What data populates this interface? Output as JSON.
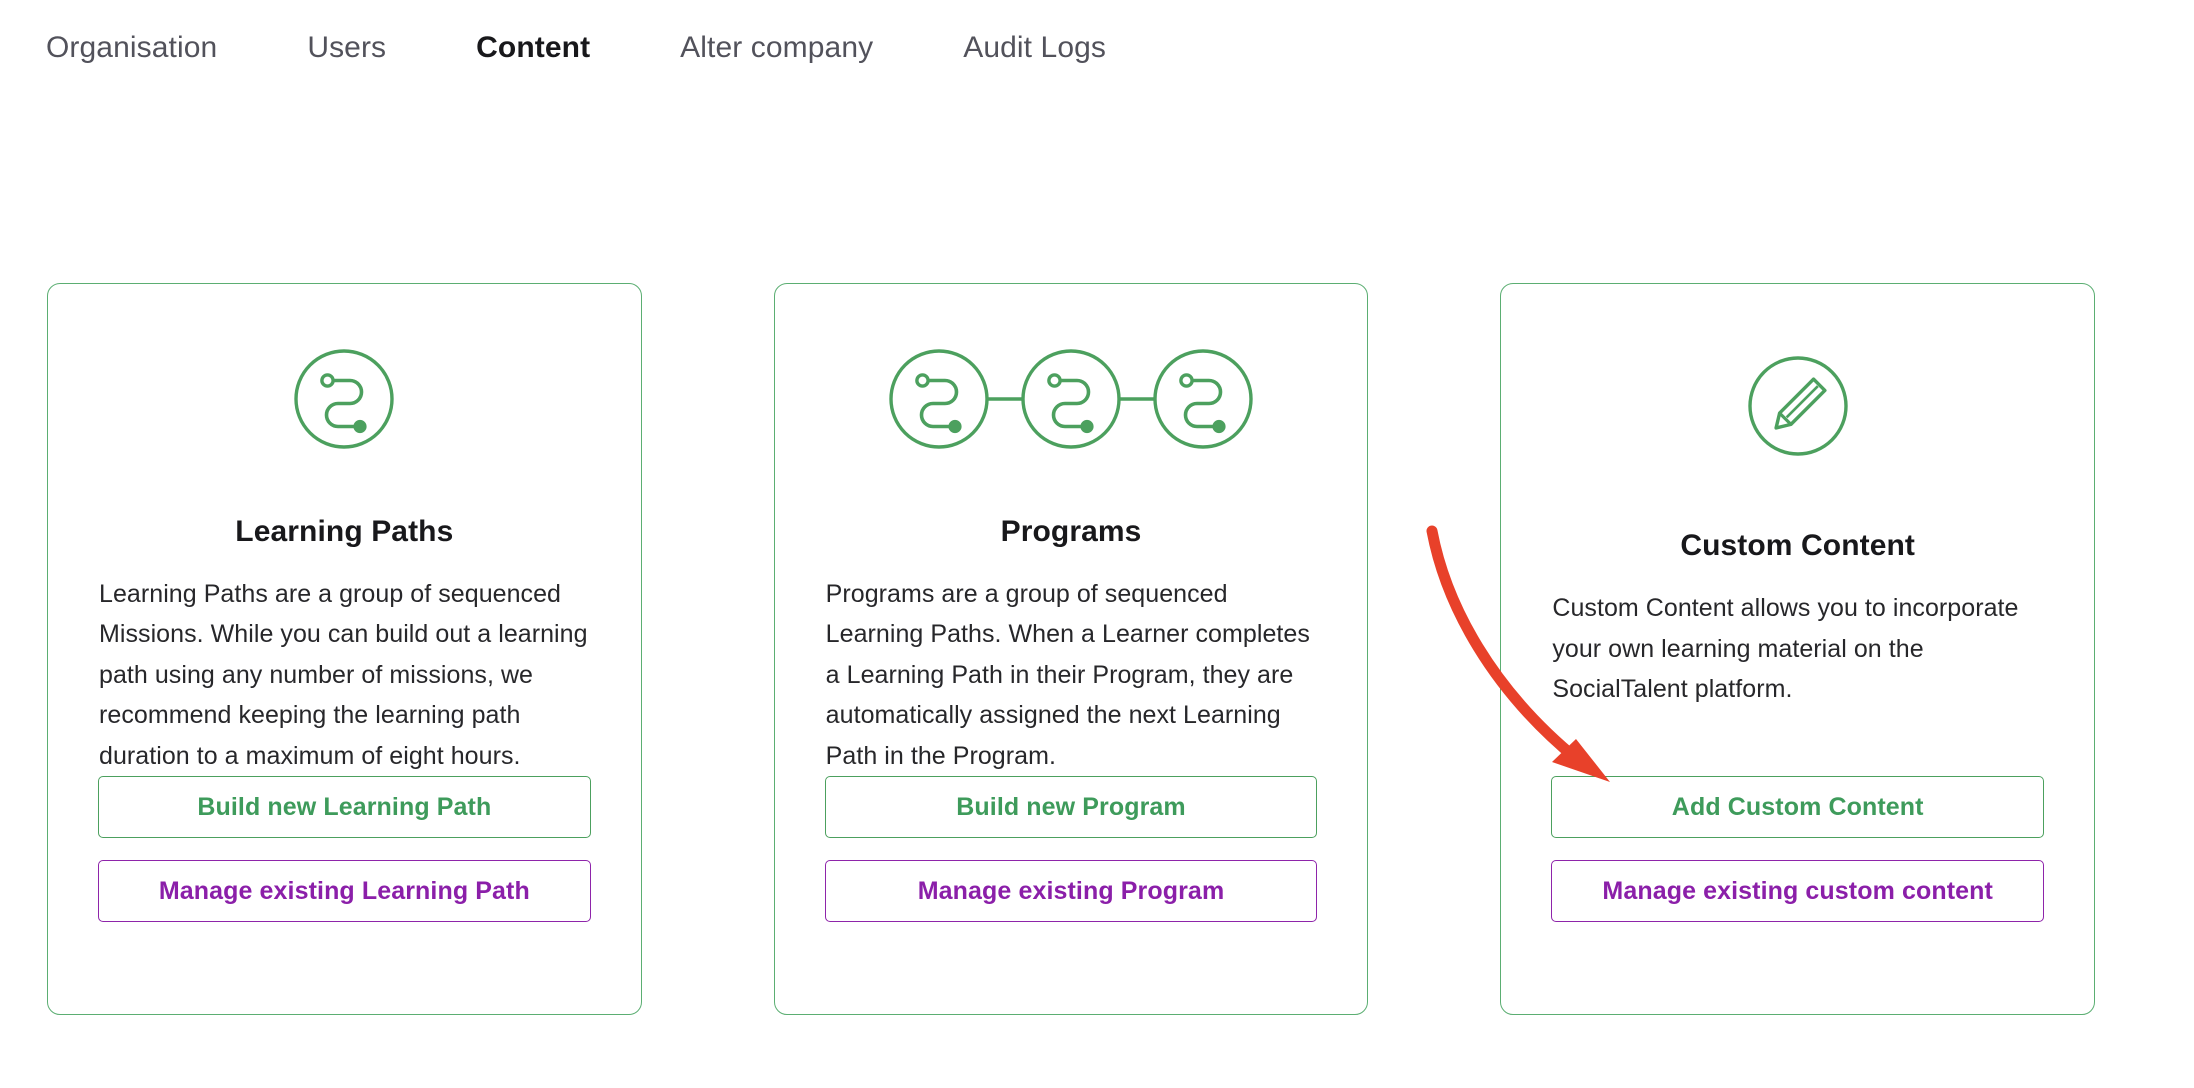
{
  "nav": {
    "tabs": [
      {
        "label": "Organisation",
        "active": false
      },
      {
        "label": "Users",
        "active": false
      },
      {
        "label": "Content",
        "active": true
      },
      {
        "label": "Alter company",
        "active": false
      },
      {
        "label": "Audit Logs",
        "active": false
      }
    ]
  },
  "colors": {
    "green_border": "#5BAE72",
    "green_text": "#3E9B5B",
    "purple": "#8B1FA9",
    "annotation_red": "#E8412A",
    "heading_text": "#18181b",
    "body_text": "#27272a",
    "nav_inactive": "#52525b"
  },
  "cards": [
    {
      "id": "learning-paths",
      "icon": "learning-path-icon",
      "title": "Learning Paths",
      "description": "Learning Paths are a group of sequenced Missions. While you can build out a learning path using any number of missions, we recommend keeping the learning path duration to a maximum of eight hours.",
      "primary_button": "Build new Learning Path",
      "secondary_button": "Manage existing Learning Path"
    },
    {
      "id": "programs",
      "icon": "program-chain-icon",
      "title": "Programs",
      "description": "Programs are a group of sequenced Learning Paths. When a Learner completes a Learning Path in their Program, they are automatically assigned the next Learning Path in the Program.",
      "primary_button": "Build new Program",
      "secondary_button": "Manage existing Program"
    },
    {
      "id": "custom-content",
      "icon": "pencil-icon",
      "title": "Custom Content",
      "description": "Custom Content allows you to incorporate your own learning material on the SocialTalent platform.",
      "primary_button": "Add Custom Content",
      "secondary_button": "Manage existing custom content"
    }
  ],
  "annotation": {
    "type": "curved-arrow",
    "color": "#E8412A",
    "points_to": "Add Custom Content"
  }
}
